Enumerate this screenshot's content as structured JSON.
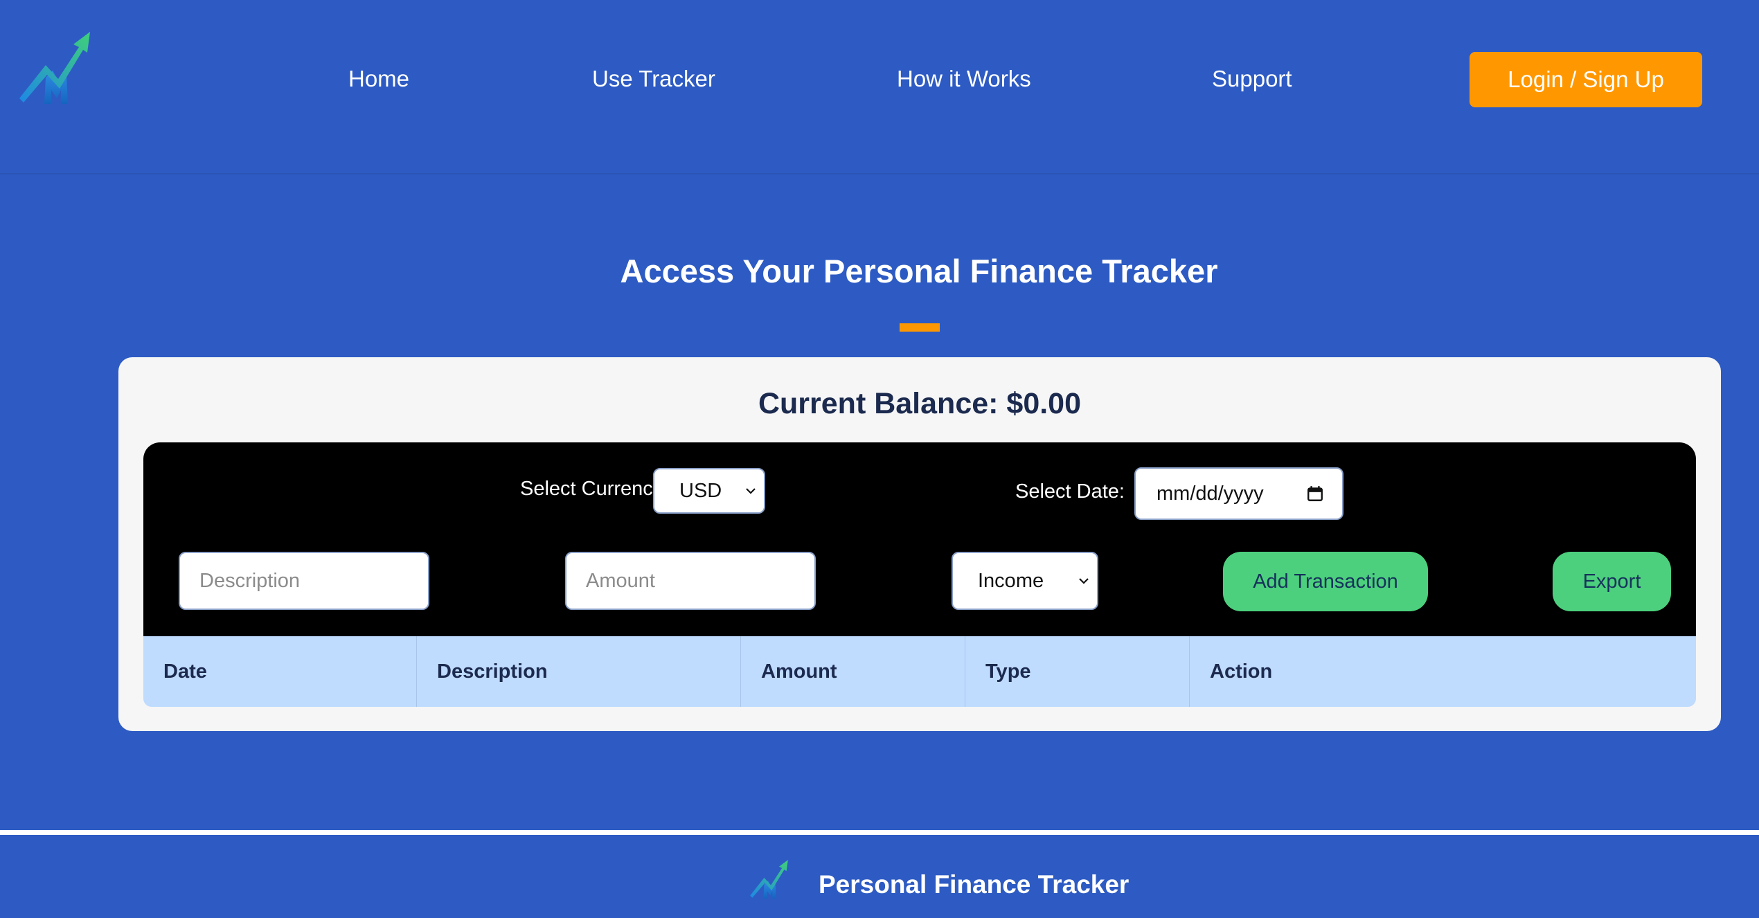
{
  "nav": {
    "logo": "finance-growth-logo",
    "links": [
      "Home",
      "Use Tracker",
      "How it Works",
      "Support"
    ],
    "login_label": "Login / Sign Up"
  },
  "hero": {
    "title": "Access Your Personal Finance Tracker"
  },
  "tracker": {
    "balance_text": "Current Balance: $0.00",
    "currency_label": "Select Currency:",
    "currency_value": "USD",
    "date_label": "Select Date:",
    "date_placeholder": "mm/dd/yyyy",
    "description_placeholder": "Description",
    "amount_placeholder": "Amount",
    "type_value": "Income",
    "add_label": "Add Transaction",
    "export_label": "Export"
  },
  "table": {
    "columns": [
      "Date",
      "Description",
      "Amount",
      "Type",
      "Action"
    ],
    "rows": []
  },
  "footer": {
    "title": "Personal Finance Tracker"
  },
  "colors": {
    "background": "#2d5bc3",
    "accent": "#ff9800",
    "button_green": "#4cd07d",
    "table_header": "#bfdbfe"
  }
}
